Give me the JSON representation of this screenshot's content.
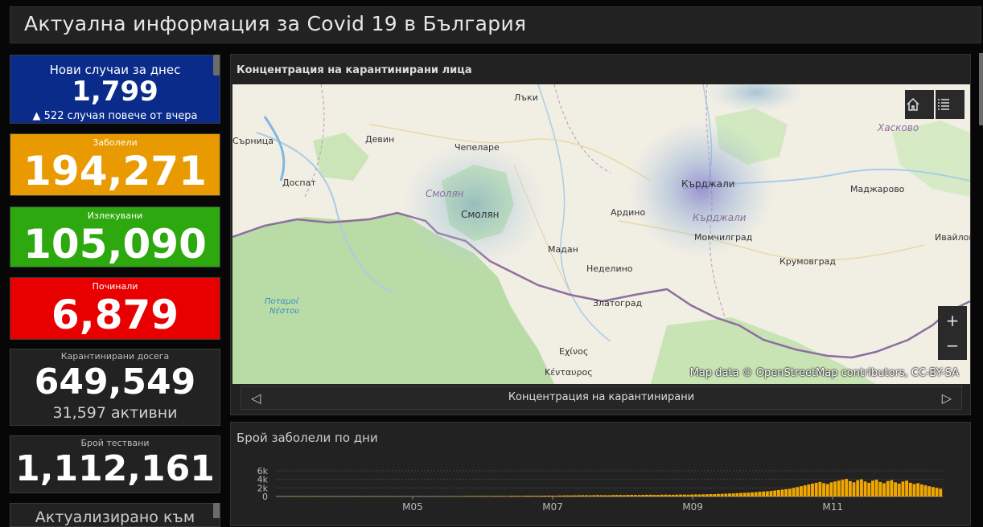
{
  "header": {
    "title": "Актуална информация за Covid 19 в България"
  },
  "cards": {
    "new_cases": {
      "label": "Нови случаи за днес",
      "value": "1,799",
      "delta": "▲ 522 случая повече от вчера"
    },
    "sick": {
      "label": "Заболели",
      "value": "194,271"
    },
    "healed": {
      "label": "Излекувани",
      "value": "105,090"
    },
    "dead": {
      "label": "Починали",
      "value": "6,879"
    },
    "quarantined": {
      "label": "Карантинирани досега",
      "value": "649,549",
      "active": "31,597 активни"
    },
    "tests": {
      "label": "Брой тествани",
      "value": "1,112,161"
    },
    "updated": {
      "label": "Актуализирано към"
    }
  },
  "map": {
    "title": "Концентрация на карантинирани лица",
    "attribution": "Map data © OpenStreetMap contributors, CC-BY-SA",
    "nav_label": "Концентрация на карантинирани",
    "home_icon": "home-icon",
    "legend_icon": "list-icon",
    "zoom_in": "+",
    "zoom_out": "−",
    "places": {
      "lyaki": "Лъки",
      "haskovo": "Хасково",
      "sarnitsa": "Сърница",
      "devin": "Девин",
      "chepelare": "Чепеларе",
      "smolyan_region": "Смолян",
      "smolyan": "Смолян",
      "dospat": "Доспат",
      "kardzhali": "Кърджали",
      "kardzhali_region": "Кърджали",
      "madzharovo": "Маджарово",
      "ardino": "Ардино",
      "momchilgrad": "Момчилград",
      "ivaylovgrad": "Ивайлов",
      "krumovgrad": "Крумовград",
      "madan": "Мадан",
      "nedelino": "Неделино",
      "zlatograd": "Златоград",
      "potamoi": "Ποταμοί",
      "nestou": "Νέστου",
      "echinos": "Εχίνος",
      "kentavros": "Κένταυρος"
    }
  },
  "chart": {
    "title": "Брой заболели по дни"
  },
  "chart_data": {
    "type": "bar",
    "title": "Брой заболели по дни",
    "ytick_labels": [
      "6k",
      "4k",
      "2k",
      "0"
    ],
    "xtick_labels": [
      "M05",
      "M07",
      "M09",
      "M11"
    ],
    "ylim": [
      0,
      6000
    ],
    "series": [
      {
        "values": [
          40,
          60,
          50,
          80,
          70,
          90,
          60,
          50,
          40,
          70,
          80,
          90,
          60,
          50,
          70,
          80,
          40,
          60,
          70,
          50,
          90,
          80,
          60,
          40,
          30,
          50,
          60,
          70,
          80,
          90,
          50,
          40,
          60,
          70,
          80,
          40,
          30,
          50,
          60,
          40,
          30,
          40,
          50,
          60,
          70,
          60,
          80,
          70,
          60,
          90,
          100,
          120,
          110,
          90,
          130,
          120,
          100,
          110,
          140,
          130,
          120,
          100,
          150,
          160,
          140,
          130,
          170,
          180,
          160,
          150,
          190,
          200,
          210,
          180,
          170,
          220,
          230,
          250,
          240,
          260,
          280,
          300,
          290,
          270,
          310,
          320,
          300,
          290,
          280,
          330,
          350,
          340,
          320,
          360,
          380,
          350,
          340,
          370,
          390,
          400,
          380,
          360,
          410,
          420,
          400,
          390,
          430,
          440,
          450,
          420,
          460,
          480,
          470,
          500,
          520,
          540,
          560,
          600,
          620,
          650,
          700,
          720,
          780,
          820,
          860,
          900,
          950,
          1000,
          1100,
          1150,
          1200,
          1300,
          1400,
          1500,
          1600,
          1700,
          1800,
          2000,
          2200,
          2400,
          2600,
          2800,
          3000,
          3200,
          3400,
          3100,
          2900,
          3300,
          3500,
          3700,
          3900,
          4100,
          3600,
          3300,
          3800,
          4000,
          3500,
          3200,
          3700,
          3900,
          3400,
          3100,
          3600,
          3800,
          3300,
          3000,
          3500,
          3700,
          3200,
          2900,
          3100,
          2800,
          2600,
          2400,
          2200,
          2000,
          1800
        ]
      }
    ]
  }
}
